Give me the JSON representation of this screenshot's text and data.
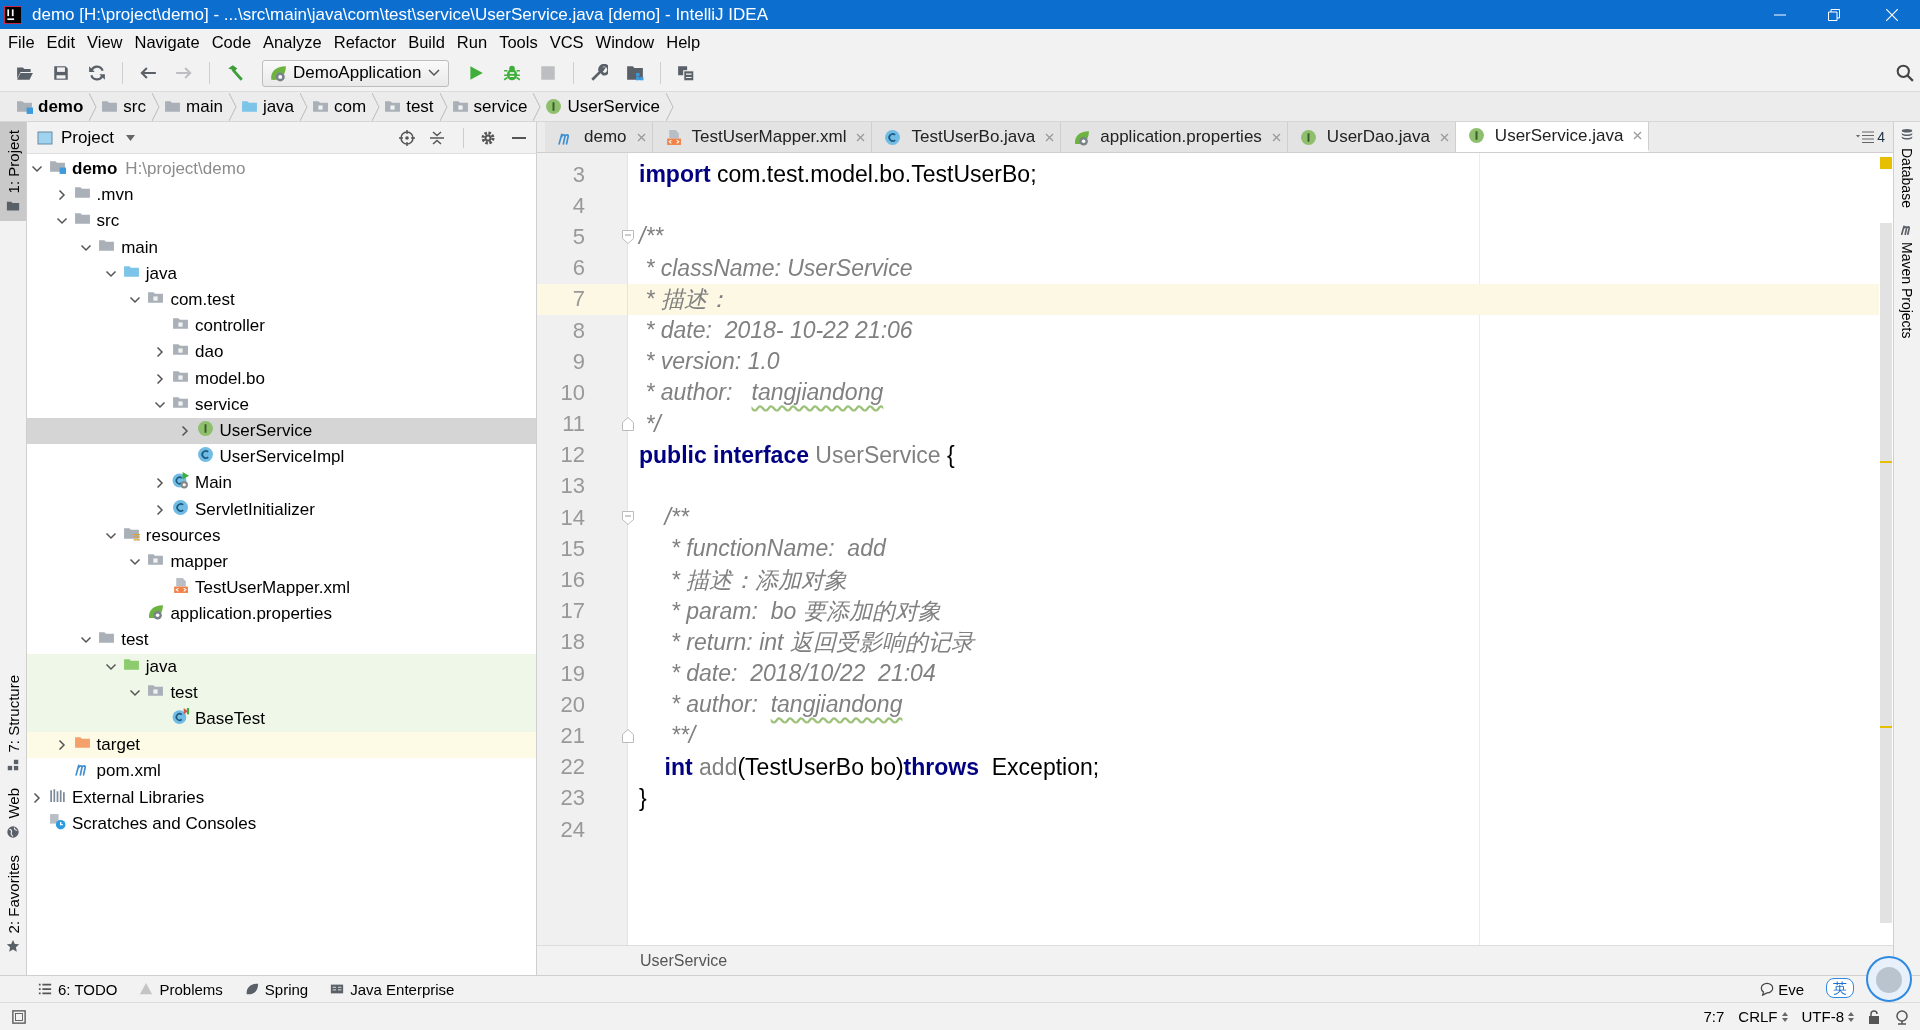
{
  "window": {
    "title": "demo [H:\\project\\demo] - ...\\src\\main\\java\\com\\test\\service\\UserService.java [demo] - IntelliJ IDEA"
  },
  "menu": [
    "File",
    "Edit",
    "View",
    "Navigate",
    "Code",
    "Analyze",
    "Refactor",
    "Build",
    "Run",
    "Tools",
    "VCS",
    "Window",
    "Help"
  ],
  "toolbar": {
    "items": [
      {
        "kind": "open",
        "disabled": false
      },
      {
        "kind": "save",
        "disabled": false
      },
      {
        "kind": "sync",
        "disabled": false
      },
      {
        "kind": "separator"
      },
      {
        "kind": "back",
        "disabled": false
      },
      {
        "kind": "forward",
        "disabled": true
      },
      {
        "kind": "separator"
      },
      {
        "kind": "build",
        "disabled": false
      },
      {
        "kind": "run-config",
        "label": "DemoApplication"
      },
      {
        "kind": "run",
        "disabled": false
      },
      {
        "kind": "debug",
        "disabled": false
      },
      {
        "kind": "stop",
        "disabled": true
      },
      {
        "kind": "separator"
      },
      {
        "kind": "wrench",
        "disabled": false
      },
      {
        "kind": "structure",
        "disabled": false
      },
      {
        "kind": "separator"
      },
      {
        "kind": "sdk",
        "disabled": false
      }
    ]
  },
  "breadcrumbs": [
    {
      "label": "demo",
      "kind": "module"
    },
    {
      "label": "src",
      "kind": "folder"
    },
    {
      "label": "main",
      "kind": "folder"
    },
    {
      "label": "java",
      "kind": "source"
    },
    {
      "label": "com",
      "kind": "package"
    },
    {
      "label": "test",
      "kind": "package"
    },
    {
      "label": "service",
      "kind": "package"
    },
    {
      "label": "UserService",
      "kind": "interface"
    }
  ],
  "left_tool_windows": {
    "top": [
      {
        "label": "1: Project",
        "kind": "project",
        "selected": true
      }
    ],
    "bottom": [
      {
        "label": "7: Structure",
        "kind": "structure",
        "selected": false
      },
      {
        "label": "Web",
        "kind": "web",
        "selected": false
      },
      {
        "label": "2: Favorites",
        "kind": "favorites",
        "selected": false
      }
    ]
  },
  "project": {
    "title": "Project",
    "tree": [
      {
        "label": "demo",
        "path": "H:\\project\\demo",
        "kind": "module",
        "expanded": true,
        "selected": false,
        "children": [
          {
            "label": ".mvn",
            "kind": "folder",
            "expanded": false,
            "selected": false
          },
          {
            "label": "src",
            "kind": "folder",
            "expanded": true,
            "selected": false,
            "children": [
              {
                "label": "main",
                "kind": "folder",
                "expanded": true,
                "selected": false,
                "children": [
                  {
                    "label": "java",
                    "kind": "source",
                    "expanded": true,
                    "selected": false,
                    "children": [
                      {
                        "label": "com.test",
                        "kind": "package",
                        "expanded": true,
                        "selected": false,
                        "children": [
                          {
                            "label": "controller",
                            "kind": "package",
                            "selected": false
                          },
                          {
                            "label": "dao",
                            "kind": "package",
                            "expanded": false,
                            "selected": false
                          },
                          {
                            "label": "model.bo",
                            "kind": "package",
                            "expanded": false,
                            "selected": false
                          },
                          {
                            "label": "service",
                            "kind": "package",
                            "expanded": true,
                            "selected": false,
                            "children": [
                              {
                                "label": "UserService",
                                "kind": "interface",
                                "expanded": false,
                                "selected": true
                              },
                              {
                                "label": "UserServiceImpl",
                                "kind": "class",
                                "selected": false
                              }
                            ]
                          },
                          {
                            "label": "Main",
                            "kind": "main-class",
                            "expanded": false,
                            "selected": false
                          },
                          {
                            "label": "ServletInitializer",
                            "kind": "class",
                            "expanded": false,
                            "selected": false
                          }
                        ]
                      }
                    ]
                  },
                  {
                    "label": "resources",
                    "kind": "resources",
                    "expanded": true,
                    "selected": false,
                    "children": [
                      {
                        "label": "mapper",
                        "kind": "package",
                        "expanded": true,
                        "selected": false,
                        "children": [
                          {
                            "label": "TestUserMapper.xml",
                            "kind": "xml",
                            "selected": false
                          }
                        ]
                      },
                      {
                        "label": "application.properties",
                        "kind": "spring",
                        "selected": false
                      }
                    ]
                  }
                ]
              },
              {
                "label": "test",
                "kind": "folder",
                "expanded": true,
                "selected": false,
                "children": [
                  {
                    "label": "java",
                    "kind": "test-source",
                    "test_scope": true,
                    "expanded": true,
                    "selected": false,
                    "children": [
                      {
                        "label": "test",
                        "kind": "package",
                        "test_scope": true,
                        "expanded": true,
                        "selected": false,
                        "children": [
                          {
                            "label": "BaseTest",
                            "kind": "test-class",
                            "test_scope": true,
                            "selected": false
                          }
                        ]
                      }
                    ]
                  }
                ]
              }
            ]
          },
          {
            "label": "target",
            "kind": "excluded",
            "excluded": true,
            "expanded": false,
            "selected": false
          },
          {
            "label": "pom.xml",
            "kind": "maven",
            "selected": false
          }
        ]
      },
      {
        "label": "External Libraries",
        "kind": "libraries",
        "expanded": false,
        "selected": false
      },
      {
        "label": "Scratches and Consoles",
        "kind": "scratches",
        "selected": false
      }
    ]
  },
  "editor": {
    "tabs": [
      {
        "label": "demo",
        "kind": "maven",
        "selected": false
      },
      {
        "label": "TestUserMapper.xml",
        "kind": "xml",
        "selected": false
      },
      {
        "label": "TestUserBo.java",
        "kind": "class",
        "selected": false
      },
      {
        "label": "application.properties",
        "kind": "spring",
        "selected": false
      },
      {
        "label": "UserDao.java",
        "kind": "interface",
        "selected": false
      },
      {
        "label": "UserService.java",
        "kind": "interface",
        "selected": true
      }
    ],
    "tab_count": "4",
    "lines": [
      {
        "number": "3",
        "current": false,
        "tokens": [
          {
            "text": "import",
            "kind": "keyword"
          },
          {
            "text": " com.test.model.bo.TestUserBo;",
            "kind": "plain"
          }
        ]
      },
      {
        "number": "4",
        "current": false
      },
      {
        "number": "5",
        "current": false,
        "fold_start": true,
        "tokens": [
          {
            "text": "/**",
            "kind": "comment"
          }
        ]
      },
      {
        "number": "6",
        "current": false,
        "tokens": [
          {
            "text": " * className: UserService",
            "kind": "comment"
          }
        ]
      },
      {
        "number": "7",
        "current": true,
        "tokens": [
          {
            "text": " * 描述：",
            "kind": "comment"
          }
        ]
      },
      {
        "number": "8",
        "current": false,
        "tokens": [
          {
            "text": " * date:  2018- 10-22 21:06",
            "kind": "comment"
          }
        ]
      },
      {
        "number": "9",
        "current": false,
        "tokens": [
          {
            "text": " * version: 1.0",
            "kind": "comment"
          }
        ]
      },
      {
        "number": "10",
        "current": false,
        "tokens": [
          {
            "text": " * author:   ",
            "kind": "comment"
          },
          {
            "text": "tangjiandong",
            "kind": "typo"
          }
        ]
      },
      {
        "number": "11",
        "current": false,
        "fold_end": true,
        "tokens": [
          {
            "text": " */",
            "kind": "comment"
          }
        ]
      },
      {
        "number": "12",
        "current": false,
        "tokens": [
          {
            "text": "public interface",
            "kind": "keyword"
          },
          {
            "text": " UserService",
            "kind": "unused"
          },
          {
            "text": " {",
            "kind": "plain"
          }
        ]
      },
      {
        "number": "13",
        "current": false
      },
      {
        "number": "14",
        "current": false,
        "fold_start": true,
        "tokens": [
          {
            "text": "    /**",
            "kind": "comment"
          }
        ]
      },
      {
        "number": "15",
        "current": false,
        "tokens": [
          {
            "text": "     * functionName:  add",
            "kind": "comment"
          }
        ]
      },
      {
        "number": "16",
        "current": false,
        "tokens": [
          {
            "text": "     * 描述：添加对象",
            "kind": "comment"
          }
        ]
      },
      {
        "number": "17",
        "current": false,
        "tokens": [
          {
            "text": "     * param:  bo 要添加的对象",
            "kind": "comment"
          }
        ]
      },
      {
        "number": "18",
        "current": false,
        "tokens": [
          {
            "text": "     * return: int 返回受影响的记录",
            "kind": "comment"
          }
        ]
      },
      {
        "number": "19",
        "current": false,
        "tokens": [
          {
            "text": "     * date:  2018/10/22  21:04",
            "kind": "comment"
          }
        ]
      },
      {
        "number": "20",
        "current": false,
        "tokens": [
          {
            "text": "     * author:  ",
            "kind": "comment"
          },
          {
            "text": "tangjiandong",
            "kind": "typo"
          }
        ]
      },
      {
        "number": "21",
        "current": false,
        "fold_end": true,
        "tokens": [
          {
            "text": "     **/",
            "kind": "comment"
          }
        ]
      },
      {
        "number": "22",
        "current": false,
        "tokens": [
          {
            "text": "    int",
            "kind": "keyword"
          },
          {
            "text": " add",
            "kind": "unused"
          },
          {
            "text": "(TestUserBo bo)",
            "kind": "plain"
          },
          {
            "text": "throws",
            "kind": "keyword"
          },
          {
            "text": "  Exception;",
            "kind": "plain"
          }
        ]
      },
      {
        "number": "23",
        "current": false,
        "tokens": [
          {
            "text": "}",
            "kind": "plain"
          }
        ]
      },
      {
        "number": "24",
        "current": false
      }
    ],
    "breadcrumb": "UserService"
  },
  "right_tool_windows": [
    {
      "label": "Database",
      "kind": "database"
    },
    {
      "label": "Maven Projects",
      "kind": "maven"
    }
  ],
  "bottom_tool_windows": [
    {
      "label": "6: TODO",
      "kind": "todo"
    },
    {
      "label": "Problems",
      "kind": "problems"
    },
    {
      "label": "Spring",
      "kind": "spring"
    },
    {
      "label": "Java Enterprise",
      "kind": "javaee"
    }
  ],
  "event_log": "Eve",
  "ime_indicator": "英",
  "status_bar": {
    "position": "7:7",
    "line_separator": "CRLF",
    "encoding": "UTF-8"
  }
}
